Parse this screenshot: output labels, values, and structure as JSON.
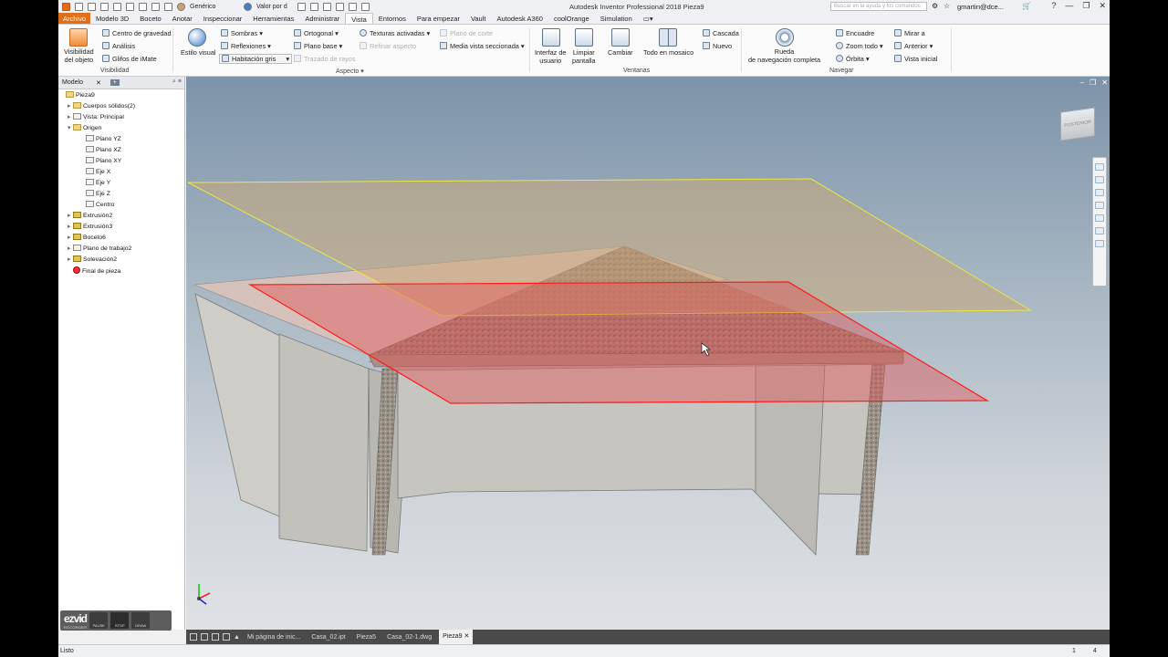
{
  "titlebar": {
    "app_title": "Autodesk Inventor Professional 2018    Pieza9",
    "material": "Genérico",
    "appearance": "Valor por d",
    "search_placeholder": "Buscar en la ayuda y los comandos",
    "user": "gmartin@dce...",
    "window_buttons": [
      "?",
      "—",
      "❐",
      "✕"
    ]
  },
  "menu": {
    "tabs": [
      "Archivo",
      "Modelo 3D",
      "Boceto",
      "Anotar",
      "Inspeccionar",
      "Herramientas",
      "Administrar",
      "Vista",
      "Entornos",
      "Para empezar",
      "Vault",
      "Autodesk A360",
      "coolOrange",
      "Simulation"
    ],
    "active": "Vista"
  },
  "ribbon": {
    "visibility": {
      "big_button": "Visibilidad\ndel objeto",
      "items": [
        "Centro de gravedad",
        "Análisis",
        "Glifos de iMate"
      ],
      "group_label": "Visibilidad"
    },
    "appearance": {
      "visual_style": "Estilo visual",
      "col1": [
        "Sombras",
        "Reflexiones",
        "Habitación gris"
      ],
      "col2": [
        "Ortogonal",
        "Plano base",
        "Trazado de rayos"
      ],
      "col3": [
        "Texturas activadas",
        "Refinar aspecto"
      ],
      "col4": [
        "Plano de corte",
        "Media vista seccionada"
      ],
      "group_label": "Aspecto"
    },
    "windows": {
      "buttons": [
        "Interfaz de\nusuario",
        "Limpiar\npantalla",
        "Cambiar",
        "Todo en mosaico"
      ],
      "items": [
        "Cascada",
        "Nuevo"
      ],
      "group_label": "Ventanas"
    },
    "navigate": {
      "wheel": "Rueda\nde navegación completa",
      "items": [
        "Encuadre",
        "Zoom todo",
        "Órbita"
      ],
      "items2": [
        "Mirar a",
        "Anterior",
        "Vista inicial"
      ],
      "group_label": "Navegar"
    }
  },
  "browser": {
    "tab_label": "Modelo",
    "tree": [
      {
        "label": "Pieza9",
        "level": 0,
        "icon": "part"
      },
      {
        "label": "Cuerpos sólidos(2)",
        "level": 1,
        "icon": "folder"
      },
      {
        "label": "Vista: Principal",
        "level": 1,
        "icon": "view"
      },
      {
        "label": "Origen",
        "level": 1,
        "icon": "folder"
      },
      {
        "label": "Plano YZ",
        "level": 2,
        "icon": "plane"
      },
      {
        "label": "Plano XZ",
        "level": 2,
        "icon": "plane"
      },
      {
        "label": "Plano XY",
        "level": 2,
        "icon": "plane"
      },
      {
        "label": "Eje X",
        "level": 2,
        "icon": "axis"
      },
      {
        "label": "Eje Y",
        "level": 2,
        "icon": "axis"
      },
      {
        "label": "Eje Z",
        "level": 2,
        "icon": "axis"
      },
      {
        "label": "Centro",
        "level": 2,
        "icon": "point"
      },
      {
        "label": "Extrusión2",
        "level": 1,
        "icon": "feature"
      },
      {
        "label": "Extrusión3",
        "level": 1,
        "icon": "feature"
      },
      {
        "label": "Boceto6",
        "level": 1,
        "icon": "sketch"
      },
      {
        "label": "Plano de trabajo2",
        "level": 1,
        "icon": "plane"
      },
      {
        "label": "Solevación2",
        "level": 1,
        "icon": "feature"
      },
      {
        "label": "Final de pieza",
        "level": 1,
        "icon": "end"
      }
    ]
  },
  "recorder": {
    "brand": "ezvid",
    "sub": "RECORDER",
    "buttons": [
      "PAUSE",
      "STOP",
      "DRAW"
    ]
  },
  "doc_tabs": [
    "Mi página de inic...",
    "Casa_02.ipt",
    "Pieza5",
    "Casa_02-1.dwg",
    "Pieza9"
  ],
  "active_doc": "Pieza9",
  "status": {
    "text": "Listo",
    "nums": [
      "1",
      "4"
    ]
  },
  "viewcube_label": "POSTERIOR"
}
